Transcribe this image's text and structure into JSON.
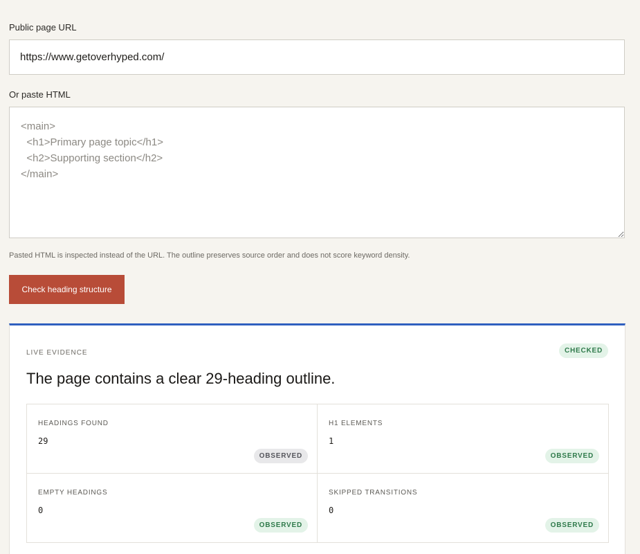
{
  "url_field": {
    "label": "Public page URL",
    "value": "https://www.getoverhyped.com/"
  },
  "html_field": {
    "label": "Or paste HTML",
    "placeholder": "<main>\n  <h1>Primary page topic</h1>\n  <h2>Supporting section</h2>\n</main>"
  },
  "helper_text": "Pasted HTML is inspected instead of the URL. The outline preserves source order and does not score keyword density.",
  "submit_label": "Check heading structure",
  "panel": {
    "eyebrow": "LIVE EVIDENCE",
    "status": "CHECKED",
    "headline": "The page contains a clear 29-heading outline.",
    "metrics": [
      {
        "label": "HEADINGS FOUND",
        "value": "29",
        "status": "OBSERVED",
        "tone": "neutral"
      },
      {
        "label": "H1 ELEMENTS",
        "value": "1",
        "status": "OBSERVED",
        "tone": "good"
      },
      {
        "label": "EMPTY HEADINGS",
        "value": "0",
        "status": "OBSERVED",
        "tone": "good"
      },
      {
        "label": "SKIPPED TRANSITIONS",
        "value": "0",
        "status": "OBSERVED",
        "tone": "good"
      }
    ]
  },
  "colors": {
    "accent_button": "#b84c38",
    "panel_top_border": "#2f5fbf",
    "good_badge_bg": "#e3f3e8",
    "good_badge_text": "#2f7a4b",
    "neutral_badge_bg": "#e8e8ea",
    "neutral_badge_text": "#55565c"
  }
}
